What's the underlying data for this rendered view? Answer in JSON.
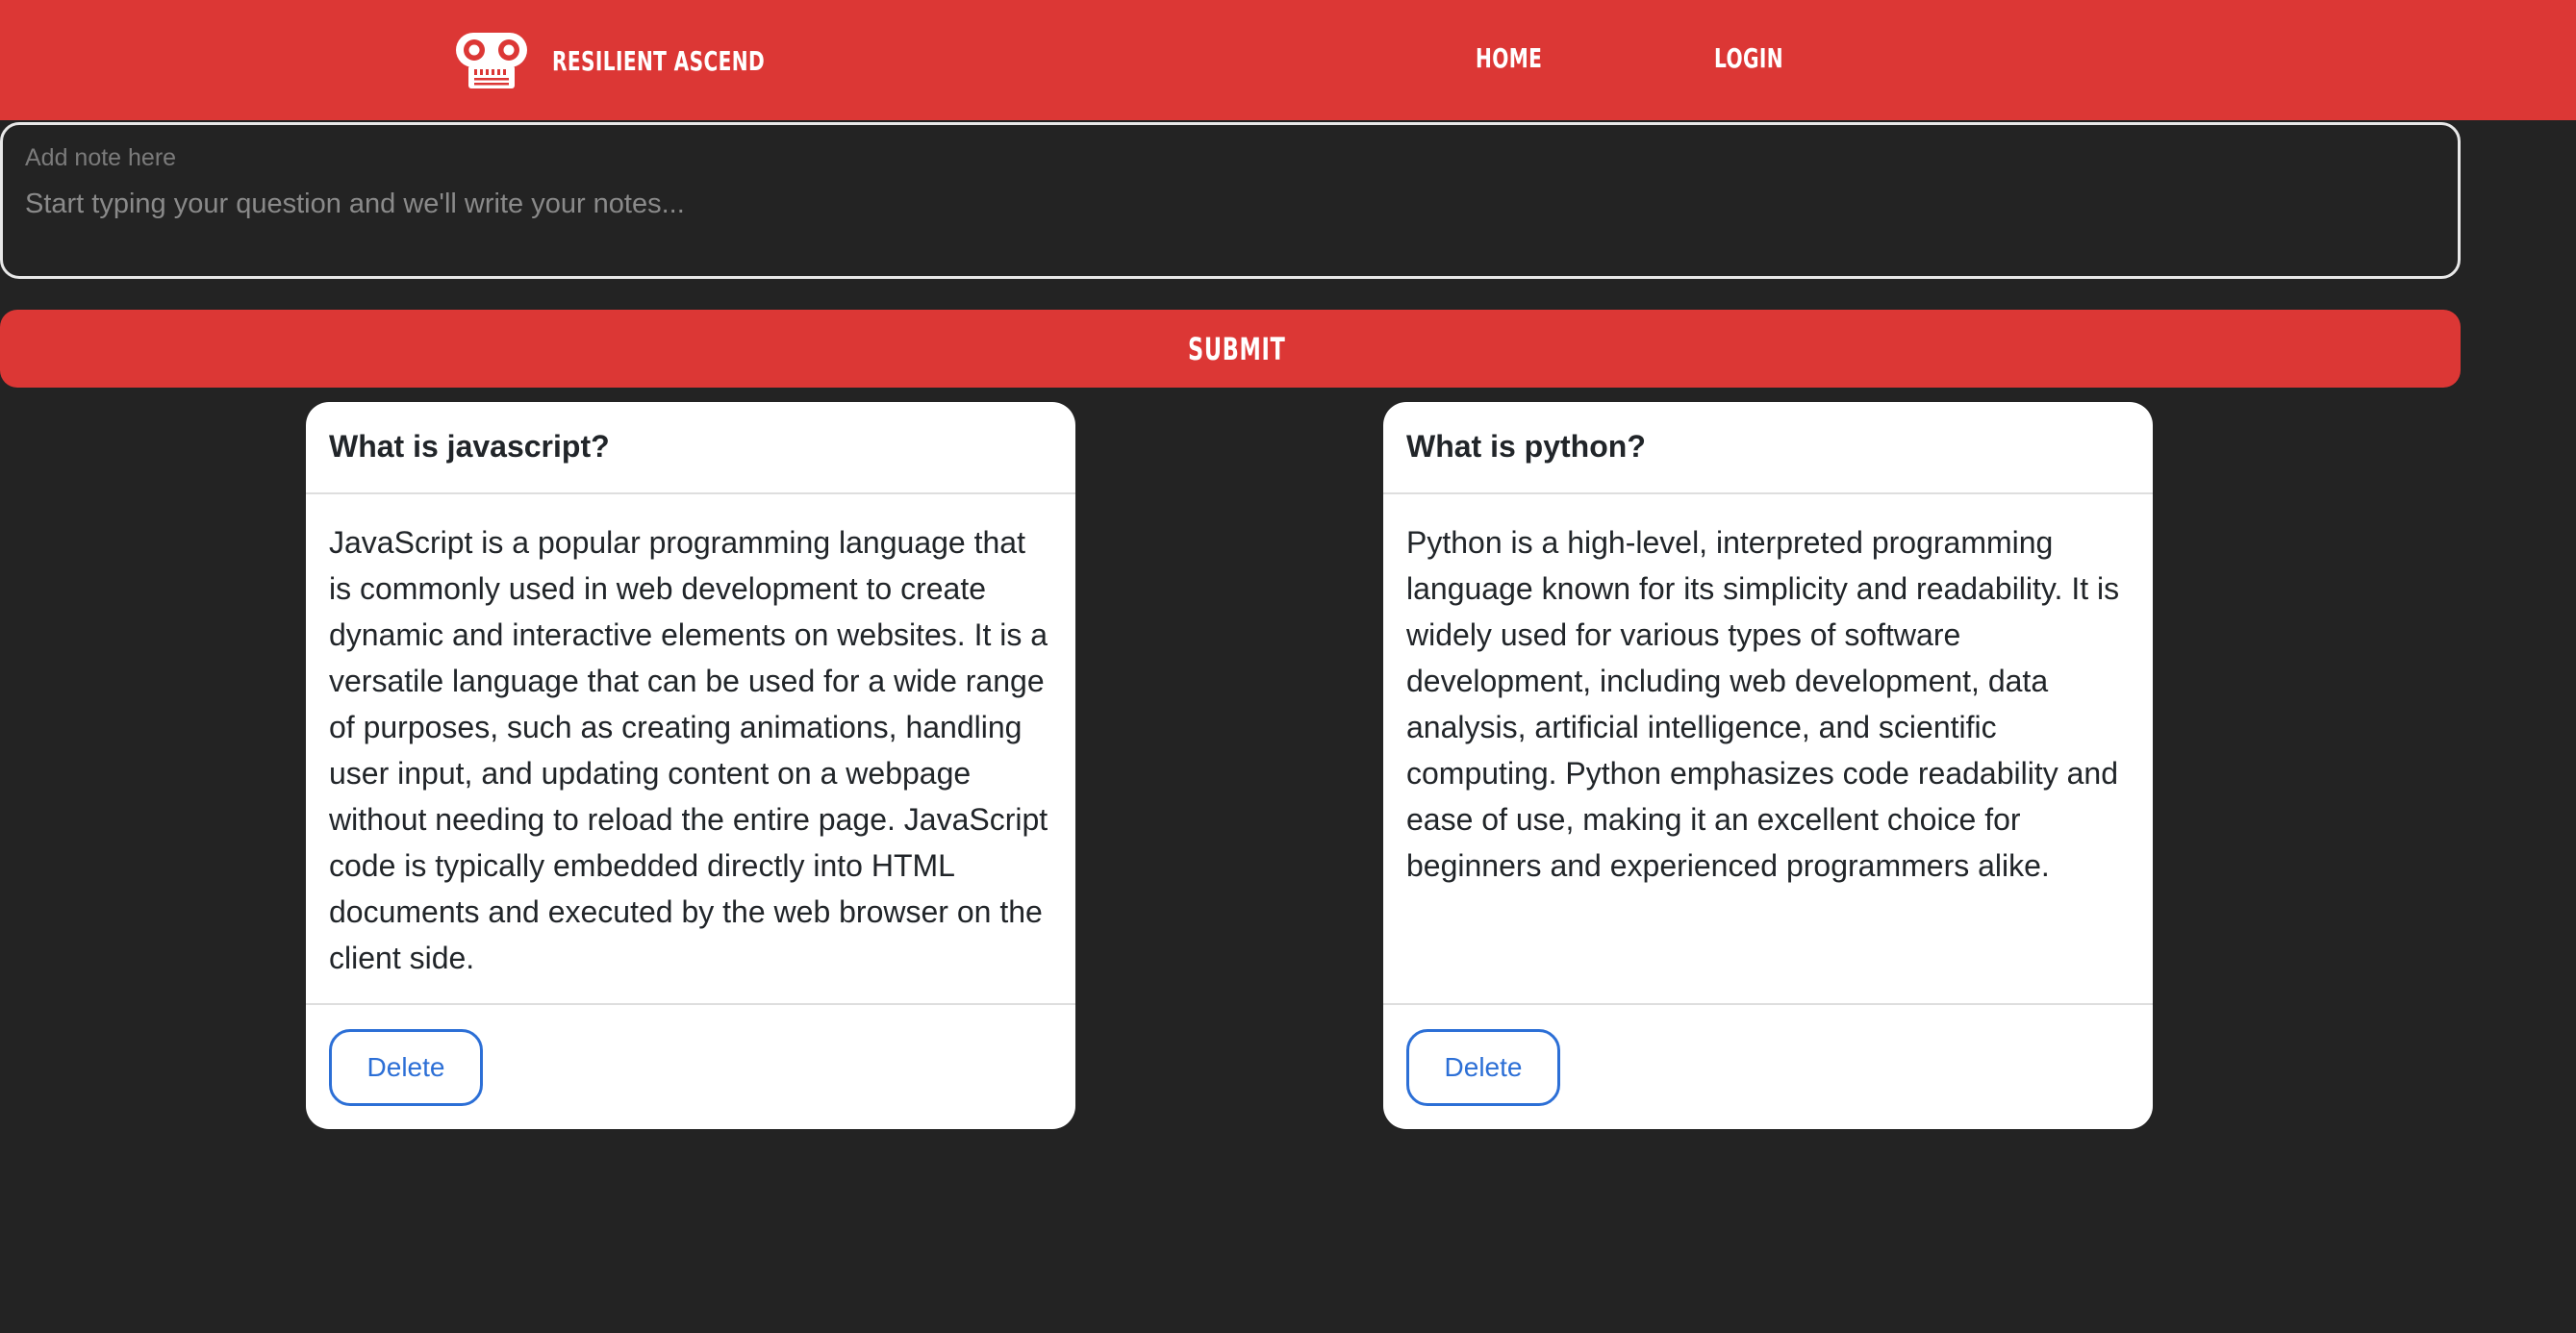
{
  "brand": {
    "name": "RESILIENT ASCEND",
    "logo_icon": "robot-skull-icon"
  },
  "nav": {
    "items": [
      {
        "label": "HOME"
      },
      {
        "label": "LOGIN"
      }
    ]
  },
  "note_form": {
    "label": "Add note here",
    "placeholder": "Start typing your question and we'll write your notes...",
    "value": "",
    "submit_label": "SUBMIT"
  },
  "notes": [
    {
      "title": "What is javascript?",
      "body": "JavaScript is a popular programming language that is commonly used in web development to create dynamic and interactive elements on websites. It is a versatile language that can be used for a wide range of purposes, such as creating animations, handling user input, and updating content on a webpage without needing to reload the entire page. JavaScript code is typically embedded directly into HTML documents and executed by the web browser on the client side.",
      "delete_label": "Delete"
    },
    {
      "title": "What is python?",
      "body": "Python is a high-level, interpreted programming language known for its simplicity and readability. It is widely used for various types of software development, including web development, data analysis, artificial intelligence, and scientific computing. Python emphasizes code readability and ease of use, making it an excellent choice for beginners and experienced programmers alike.",
      "delete_label": "Delete"
    }
  ],
  "colors": {
    "brand_red": "#dc3735",
    "page_background": "#232323",
    "card_background": "#ffffff",
    "delete_blue": "#2c6fd6"
  }
}
